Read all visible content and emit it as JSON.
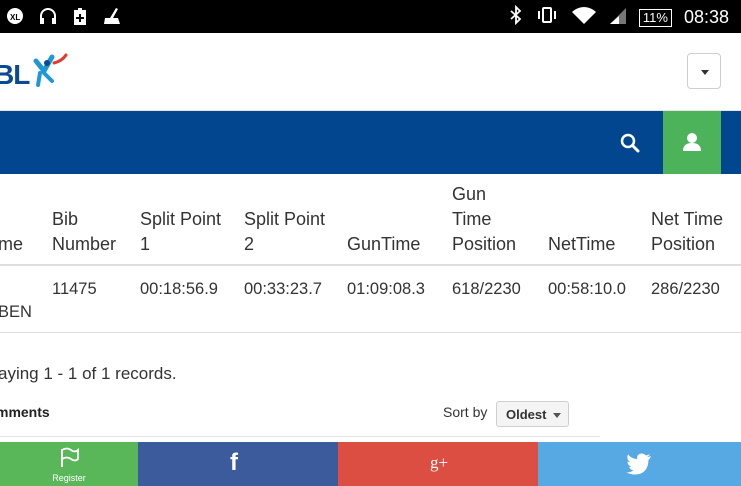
{
  "status_bar": {
    "battery": "11%",
    "time": "08:38",
    "icons": [
      "xl-badge-icon",
      "headphones-icon",
      "battery-saver-icon",
      "cleaner-icon",
      "bluetooth-icon",
      "vibrate-icon",
      "wifi-icon",
      "signal-icon"
    ]
  },
  "header": {
    "logo_text": "BL",
    "menu_icon": "chevron-down-icon"
  },
  "navbar": {
    "search_icon": "search-icon",
    "user_icon": "user-icon",
    "accent": "#4db35a",
    "bar_color": "#02468f"
  },
  "table": {
    "headers": {
      "name_partial": "me",
      "bib_l1": "Bib",
      "bib_l2": "Number",
      "split1_l1": "Split Point",
      "split1_l2": "1",
      "split2_l1": "Split Point",
      "split2_l2": "2",
      "guntime": "GunTime",
      "gtpos_l1": "Gun",
      "gtpos_l2": "Time",
      "gtpos_l3": "Position",
      "nettime": "NetTime",
      "ntpos_l1": "Net Time",
      "ntpos_l2": "Position"
    },
    "row": {
      "name_partial": "BEN",
      "bib": "11475",
      "split1": "00:18:56.9",
      "split2": "00:33:23.7",
      "guntime": "01:09:08.3",
      "gtpos": "618/2230",
      "nettime": "00:58:10.0",
      "ntpos": "286/2230"
    }
  },
  "records_text": "aying 1 - 1 of 1 records.",
  "comments": {
    "title": "mments",
    "sort_label": "Sort by",
    "sort_value": "Oldest"
  },
  "share": {
    "register_label": "Register",
    "facebook": "f",
    "google": "g+",
    "colors": {
      "register": "#59b75a",
      "facebook": "#3b5b9c",
      "google": "#dc4e41",
      "twitter": "#56a9e2"
    }
  }
}
